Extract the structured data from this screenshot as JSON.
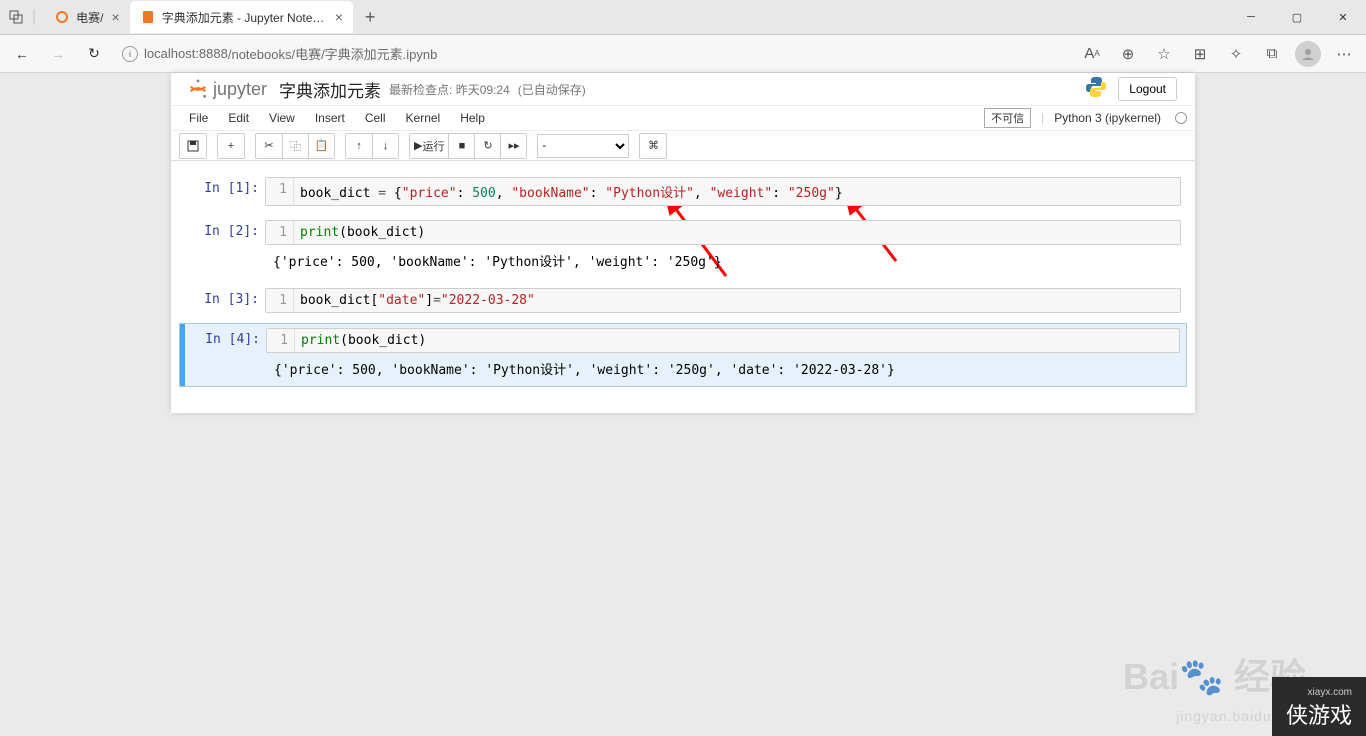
{
  "browser": {
    "tabs": [
      {
        "title": "电赛/",
        "active": false
      },
      {
        "title": "字典添加元素 - Jupyter Noteboo",
        "active": true
      }
    ],
    "url_host": "localhost",
    "url_port": ":8888",
    "url_path": "/notebooks/电赛/字典添加元素.ipynb"
  },
  "jupyter": {
    "logo_text": "jupyter",
    "notebook_name": "字典添加元素",
    "checkpoint_label": "最新检查点:",
    "checkpoint_time": "昨天09:24",
    "autosave": "(已自动保存)",
    "logout": "Logout",
    "trusted": "不可信",
    "kernel": "Python 3 (ipykernel)",
    "menus": [
      "File",
      "Edit",
      "View",
      "Insert",
      "Cell",
      "Kernel",
      "Help"
    ],
    "run_label": "运行",
    "cell_type": "-"
  },
  "cells": [
    {
      "prompt": "In [1]:",
      "line_no": "1",
      "tokens": [
        {
          "t": "book_dict ",
          "c": ""
        },
        {
          "t": "=",
          "c": "op"
        },
        {
          "t": " {",
          "c": ""
        },
        {
          "t": "\"price\"",
          "c": "str"
        },
        {
          "t": ": ",
          "c": ""
        },
        {
          "t": "500",
          "c": "num"
        },
        {
          "t": ", ",
          "c": ""
        },
        {
          "t": "\"bookName\"",
          "c": "str"
        },
        {
          "t": ": ",
          "c": ""
        },
        {
          "t": "\"Python设计\"",
          "c": "str"
        },
        {
          "t": ", ",
          "c": ""
        },
        {
          "t": "\"weight\"",
          "c": "str"
        },
        {
          "t": ": ",
          "c": ""
        },
        {
          "t": "\"250g\"",
          "c": "str"
        },
        {
          "t": "}",
          "c": ""
        }
      ]
    },
    {
      "prompt": "In [2]:",
      "line_no": "1",
      "tokens": [
        {
          "t": "print",
          "c": "fn"
        },
        {
          "t": "(book_dict)",
          "c": ""
        }
      ],
      "output": "{'price': 500, 'bookName': 'Python设计', 'weight': '250g'}"
    },
    {
      "prompt": "In [3]:",
      "line_no": "1",
      "tokens": [
        {
          "t": "book_dict[",
          "c": ""
        },
        {
          "t": "\"date\"",
          "c": "str"
        },
        {
          "t": "]",
          "c": ""
        },
        {
          "t": "=",
          "c": "op"
        },
        {
          "t": "\"2022-03-28\"",
          "c": "str"
        }
      ]
    },
    {
      "prompt": "In [4]:",
      "line_no": "1",
      "selected": true,
      "tokens": [
        {
          "t": "print",
          "c": "fn"
        },
        {
          "t": "(book_dict)",
          "c": ""
        }
      ],
      "output": "{'price': 500, 'bookName': 'Python设计', 'weight': '250g', 'date': '2022-03-28'}"
    }
  ],
  "watermark": {
    "main": "Baidu 经验",
    "sub": "jingyan.baidu.com",
    "corner_small": "xiayx.com",
    "corner_main": "侠游戏"
  }
}
